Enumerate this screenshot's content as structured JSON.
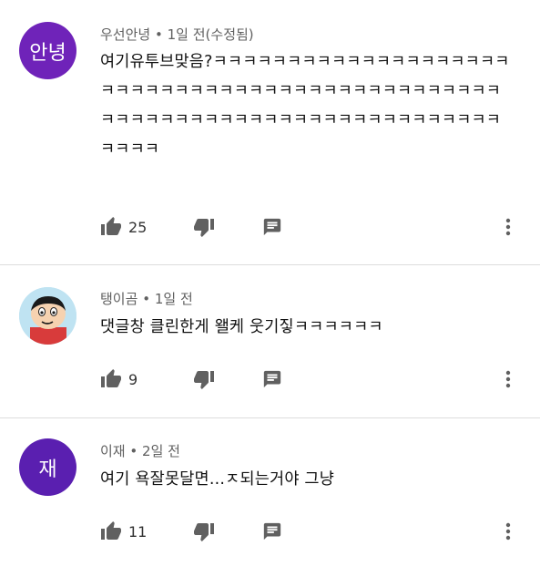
{
  "comments": [
    {
      "avatar_text": "안녕",
      "avatar_color": "#6f23b9",
      "author": "우선안녕",
      "time": "1일 전(수정됨)",
      "text": "여기유투브맞음?ㅋㅋㅋㅋㅋㅋㅋㅋㅋㅋㅋㅋㅋㅋㅋㅋㅋㅋㅋㅋㅋㅋㅋㅋㅋㅋㅋㅋㅋㅋㅋㅋㅋㅋㅋㅋㅋㅋㅋㅋㅋㅋㅋㅋㅋㅋㅋㅋㅋㅋㅋㅋㅋㅋㅋㅋㅋㅋㅋㅋㅋㅋㅋㅋㅋㅋㅋㅋㅋㅋㅋㅋㅋㅋㅋㅋㅋㅋ",
      "likes": "25"
    },
    {
      "avatar_icon": "cartoon-character-avatar",
      "author": "탱이곰",
      "time": "1일 전",
      "text": "댓글창 클린한게 왤케 웃기짛ㅋㅋㅋㅋㅋㅋ",
      "likes": "9"
    },
    {
      "avatar_text": "재",
      "avatar_color": "#5a1fb0",
      "author": "이재",
      "time": "2일 전",
      "text": "여기 욕잘못달면...ㅈ되는거야 그냥",
      "likes": "11"
    }
  ],
  "separator": "•",
  "icons": {
    "like": "thumbs-up-icon",
    "dislike": "thumbs-down-icon",
    "reply": "reply-comment-icon",
    "menu": "more-vertical-icon"
  }
}
